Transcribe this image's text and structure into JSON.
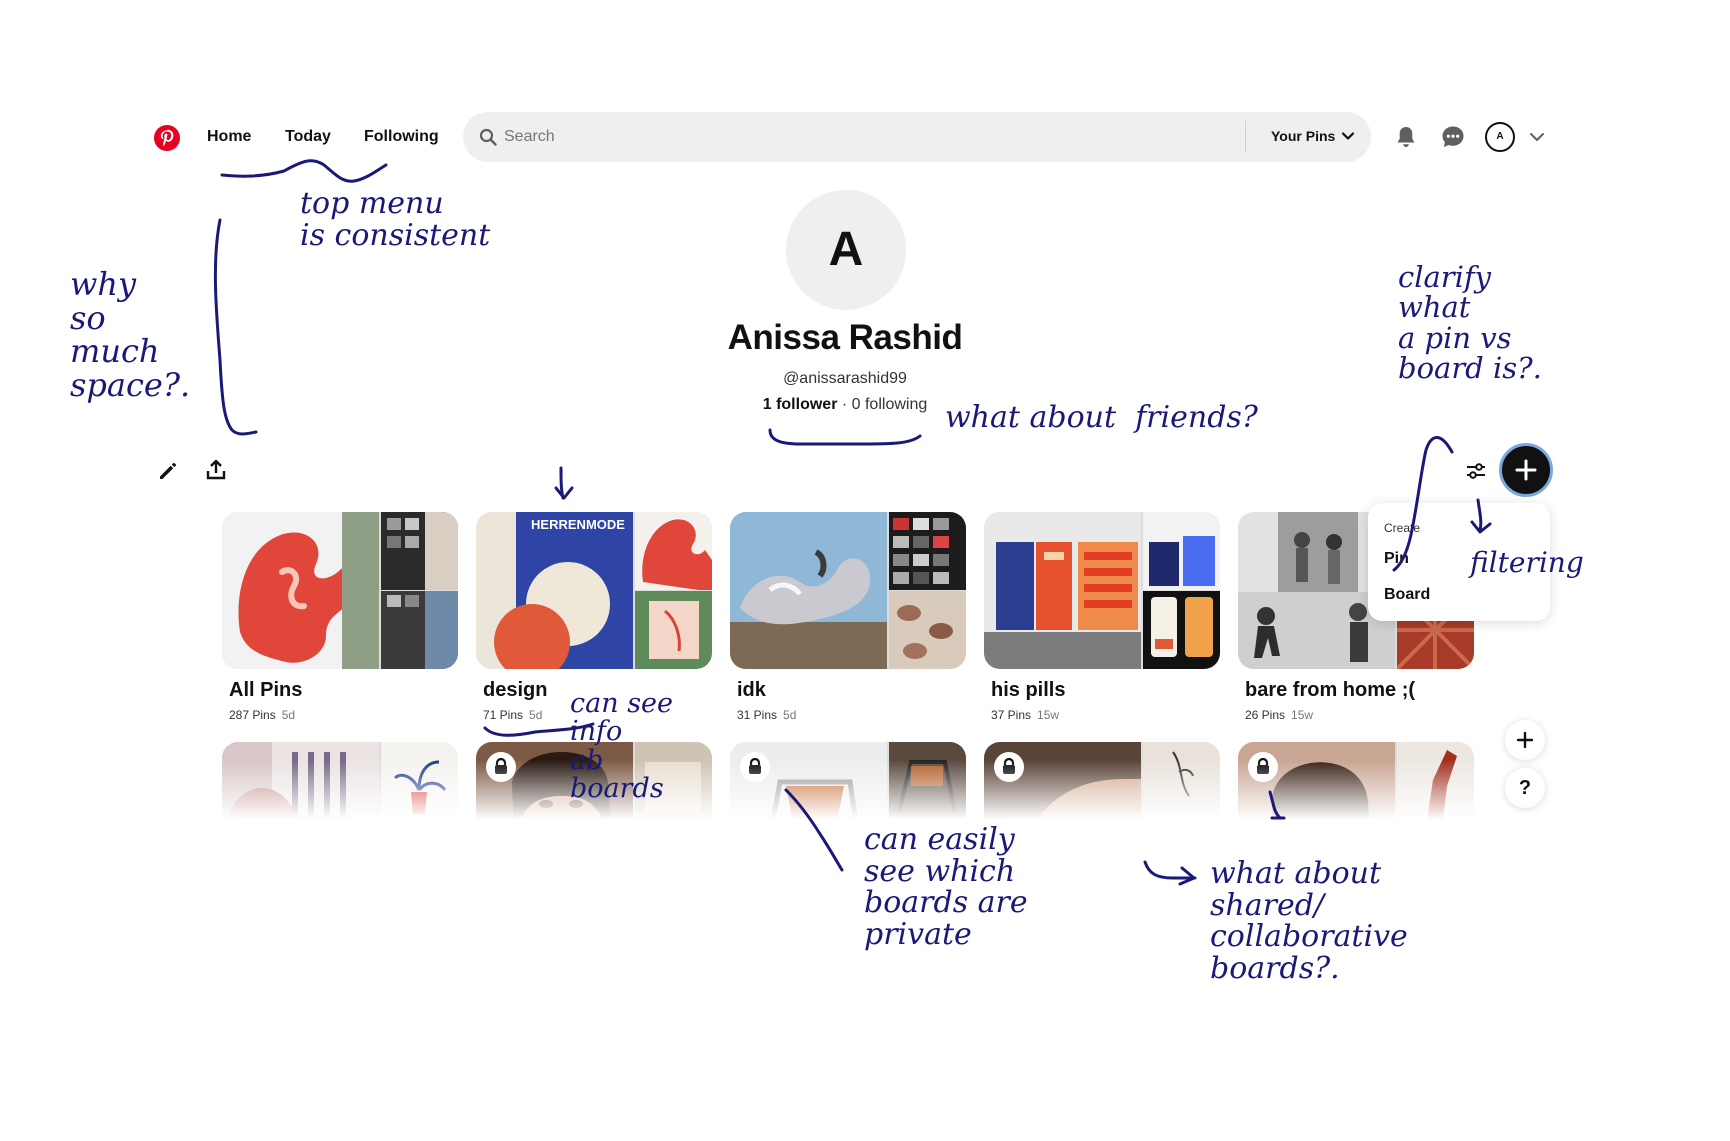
{
  "header": {
    "nav": [
      "Home",
      "Today",
      "Following"
    ],
    "search_placeholder": "Search",
    "scope_label": "Your Pins",
    "avatar_initial": "A"
  },
  "profile": {
    "initial": "A",
    "name": "Anissa Rashid",
    "handle": "@anissarashid99",
    "followers": "1 follower",
    "separator": " · ",
    "following": "0 following"
  },
  "create_menu": {
    "title": "Create",
    "items": [
      "Pin",
      "Board"
    ]
  },
  "boards": [
    {
      "title": "All Pins",
      "pins": "287 Pins",
      "age": "5d",
      "private": false
    },
    {
      "title": "design",
      "pins": "71 Pins",
      "age": "5d",
      "private": false,
      "cover_text": "HERRENMODE"
    },
    {
      "title": "idk",
      "pins": "31 Pins",
      "age": "5d",
      "private": false
    },
    {
      "title": "his pills",
      "pins": "37 Pins",
      "age": "15w",
      "private": false
    },
    {
      "title": "bare from home ;(",
      "pins": "26 Pins",
      "age": "15w",
      "private": false
    },
    {
      "private": false
    },
    {
      "private": true
    },
    {
      "private": true
    },
    {
      "private": true
    },
    {
      "private": true
    }
  ],
  "help_label": "?",
  "annotations": {
    "top_menu": "top menu\nis consistent",
    "space": "why\nso\nmuch\nspace?.",
    "friends": "what about  friends?",
    "clarify": "clarify\nwhat\na pin vs\nboard is?.",
    "filtering": "filtering",
    "info": "can see\ninfo\nab\nboards",
    "private": "can easily\nsee which\nboards are\nprivate",
    "shared": "what about\nshared/\ncollaborative\nboards?."
  },
  "colors": {
    "brand": "#e60023",
    "ink": "#1a1978",
    "surface": "#efefef"
  }
}
